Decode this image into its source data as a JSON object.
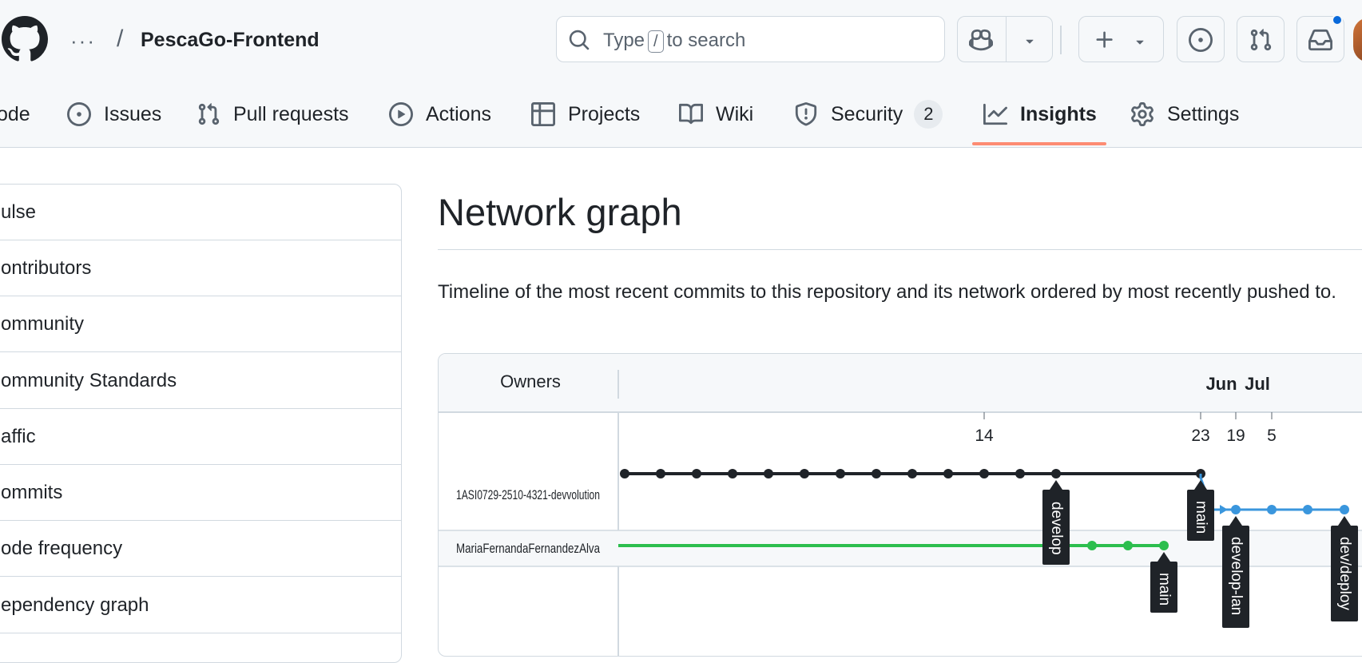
{
  "header": {
    "repo_name": "PescaGo-Frontend",
    "more_label": "···",
    "separator": "/",
    "search": {
      "prefix": "Type",
      "key": "/",
      "suffix": "to search"
    },
    "icons": [
      "github-logo-icon",
      "copilot-icon",
      "chevron-down-icon",
      "plus-icon",
      "issue-opened-icon",
      "git-pull-request-icon",
      "inbox-icon"
    ],
    "notification_color": "#0969da"
  },
  "tabs": [
    {
      "label": "ode",
      "icon": "code-icon"
    },
    {
      "label": "Issues",
      "icon": "issue-opened-icon"
    },
    {
      "label": "Pull requests",
      "icon": "git-pull-request-icon"
    },
    {
      "label": "Actions",
      "icon": "play-icon"
    },
    {
      "label": "Projects",
      "icon": "table-icon"
    },
    {
      "label": "Wiki",
      "icon": "book-icon"
    },
    {
      "label": "Security",
      "icon": "shield-icon",
      "counter": "2"
    },
    {
      "label": "Insights",
      "icon": "graph-icon",
      "active": true
    },
    {
      "label": "Settings",
      "icon": "gear-icon"
    }
  ],
  "active_tab_underline_color": "#fd8c73",
  "sidebar": {
    "items": [
      "ulse",
      "ontributors",
      "ommunity",
      "ommunity Standards",
      "affic",
      "ommits",
      "ode frequency",
      "ependency graph"
    ]
  },
  "main": {
    "title": "Network graph",
    "description": "Timeline of the most recent commits to this repository and its network ordered by most recently pushed to."
  },
  "network": {
    "owners_header": "Owners",
    "months": [
      "Jun",
      "Jul"
    ],
    "days": [
      "14",
      "23",
      "19",
      "5"
    ],
    "owners": [
      "1ASI0729-2510-4321-devvolution",
      "MariaFernandaFernandezAlva"
    ],
    "branch_labels": [
      "develop",
      "main",
      "main",
      "develop-lan",
      "dev/deploy"
    ],
    "series_colors": {
      "devvolution": "#1f2328",
      "maria": "#2cbe4e",
      "branch": "#3a96dd"
    }
  }
}
